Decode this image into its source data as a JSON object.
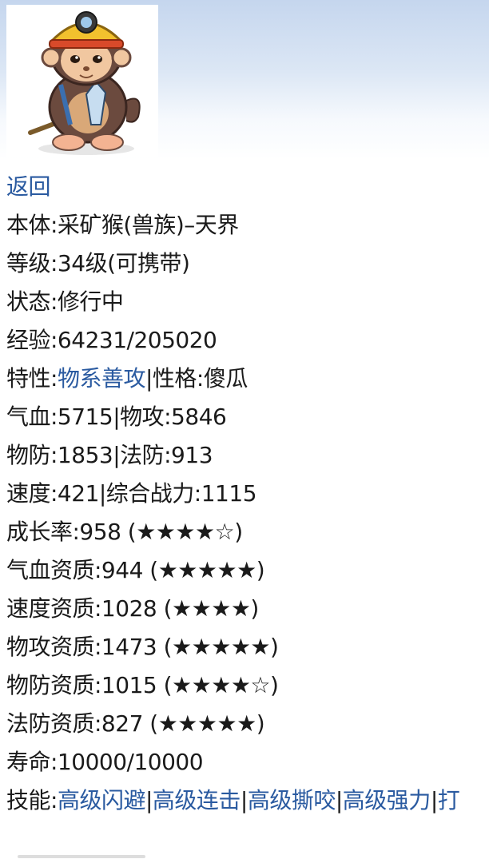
{
  "back_link": "返回",
  "info": {
    "body": "本体:采矿猴(兽族)–天界",
    "level": "等级:34级(可携带)",
    "status": "状态:修行中",
    "exp": "经验:64231/205020",
    "trait_label": "特性:",
    "trait_value": "物系善攻",
    "personality": "|性格:傻瓜",
    "hp_atk": "气血:5715|物攻:5846",
    "def_mdef": "物防:1853|法防:913",
    "speed_power": "速度:421|综合战力:1115",
    "growth": "成长率:958 (★★★★☆)",
    "hp_aptitude": "气血资质:944 (★★★★★)",
    "speed_aptitude": "速度资质:1028 (★★★★)",
    "atk_aptitude": "物攻资质:1473 (★★★★★)",
    "def_aptitude": "物防资质:1015 (★★★★☆)",
    "mdef_aptitude": "法防资质:827 (★★★★★)",
    "lifespan": "寿命:10000/10000"
  },
  "skills": {
    "label": "技能:",
    "items": [
      "高级闪避",
      "高级连击",
      "高级撕咬",
      "高级强力",
      "打"
    ],
    "separator": "|"
  },
  "colors": {
    "link": "#2a5aa0",
    "text": "#1a1a1a",
    "banner": "#c5d6ee"
  },
  "icons": {
    "portrait": "mining-monkey-portrait"
  }
}
